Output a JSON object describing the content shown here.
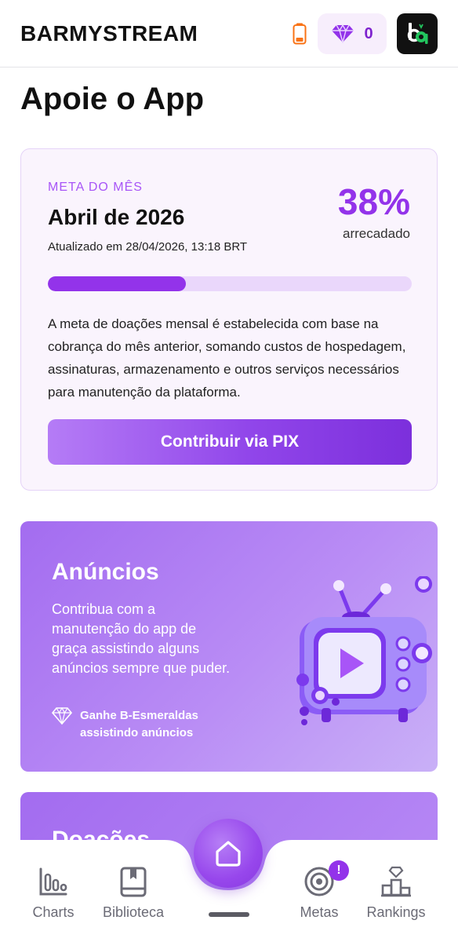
{
  "header": {
    "brand": "BARMYSTREAM",
    "gem_count": "0",
    "icons": [
      "battery-icon",
      "gem-icon",
      "app-logo"
    ]
  },
  "page": {
    "title": "Apoie o App"
  },
  "goal": {
    "kicker": "META DO MÊS",
    "month": "Abril de 2026",
    "updated": "Atualizado em 28/04/2026, 13:18 BRT",
    "percent_label": "38%",
    "percent_value": 0.38,
    "raised_label": "arrecadado",
    "description": "A meta de doações mensal é estabelecida com base na cobrança do mês anterior, somando custos de hospedagem, assinaturas, armazenamento e outros serviços necessários para manutenção da plataforma.",
    "button": "Contribuir via PIX"
  },
  "ads": {
    "title": "Anúncios",
    "text": "Contribua com a manutenção do app de graça assistindo alguns anúncios sempre que puder.",
    "reward_line1": "Ganhe B-Esmeraldas",
    "reward_line2": "assistindo anúncios"
  },
  "donations": {
    "title": "Doações"
  },
  "nav": {
    "charts": "Charts",
    "library": "Biblioteca",
    "goals": "Metas",
    "goals_badge": "!",
    "rankings": "Rankings"
  },
  "colors": {
    "accent": "#9333ea",
    "accent_light": "#ead7fb",
    "card_bg": "#faf4fd"
  }
}
